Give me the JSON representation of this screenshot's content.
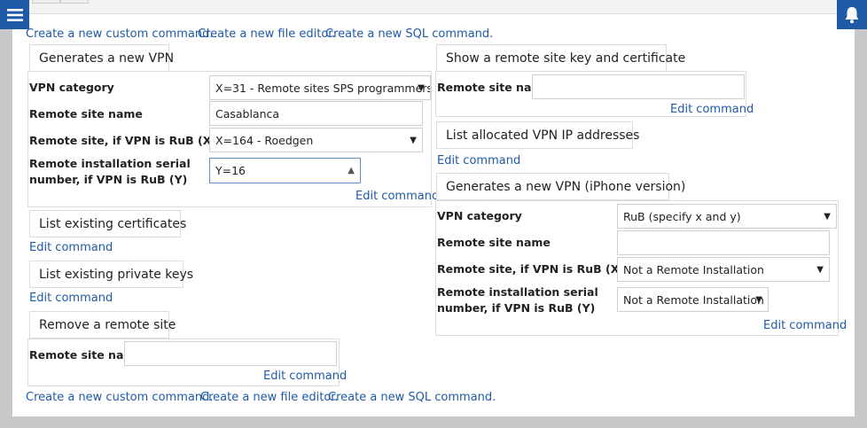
{
  "top_links": {
    "custom": "Create a new custom command.",
    "file": "Create a new file editor.",
    "sql": "Create a new SQL command."
  },
  "bottom_links": {
    "custom": "Create a new custom command.",
    "file": "Create a new file editor.",
    "sql": "Create a new SQL command."
  },
  "edit_label": "Edit command",
  "gen_vpn": {
    "title": "Generates a new VPN",
    "vpn_category_label": "VPN category",
    "vpn_category_value": "X=31 - Remote sites SPS programmers",
    "site_name_label": "Remote site name",
    "site_name_value": "Casablanca",
    "remote_site_label": "Remote site, if VPN is RuB (X)",
    "remote_site_value": "X=164 - Roedgen",
    "serial_label": "Remote installation serial number, if VPN is RuB (Y)",
    "serial_value": "Y=16"
  },
  "list_certs": {
    "title": "List existing certificates"
  },
  "list_keys": {
    "title": "List existing private keys"
  },
  "remove_site": {
    "title": "Remove a remote site",
    "site_name_label": "Remote site name",
    "site_name_value": ""
  },
  "show_key": {
    "title": "Show a remote site key and certificate",
    "site_name_label": "Remote site name",
    "site_name_value": ""
  },
  "list_ip": {
    "title": "List allocated VPN IP addresses"
  },
  "gen_vpn_iphone": {
    "title": "Generates a new VPN (iPhone version)",
    "vpn_category_label": "VPN category",
    "vpn_category_value": "RuB (specify x and y)",
    "site_name_label": "Remote site name",
    "site_name_value": "",
    "remote_site_label": "Remote site, if VPN is RuB (X)",
    "remote_site_value": "Not a Remote Installation",
    "serial_label": "Remote installation serial number, if VPN is RuB (Y)",
    "serial_value": "Not a Remote Installation"
  },
  "icons": {
    "menu": "menu-icon",
    "notifications": "bell-icon"
  },
  "colors": {
    "accent": "#1f5aa6",
    "background": "#c8c8c8"
  }
}
